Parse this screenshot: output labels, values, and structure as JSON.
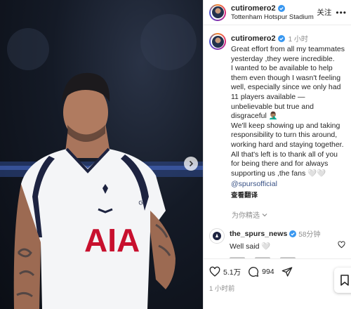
{
  "post": {
    "username": "cutiromero2",
    "location": "Tottenham Hotspur Stadium",
    "follow_label": "关注",
    "time_ago": "1 小时",
    "caption": "Great effort from all my teammates yesterday ,they were incredible.\nI wanted to be available to help them even though I wasn't feeling well, especially since we only had 11 players available — unbelievable but true  and disgraceful 🤦🏽‍♂️\nWe'll keep showing up and taking responsibility to turn this around, working hard and staying together.\nAll that's left is to thank all of you for being there and for always supporting us ,the fans 🤍🤍",
    "mention": "@spursofficial",
    "translate_label": "查看翻译",
    "for_you_label": "为你精选"
  },
  "comment": {
    "username": "the_spurs_news",
    "time_ago": "58分钟",
    "text": "Well said 🤍"
  },
  "actions": {
    "likes": "5.1万",
    "comments": "994",
    "posted": "1 小时前"
  },
  "photo": {
    "jersey_text": "AIA",
    "sleeve_text": "GA"
  },
  "colors": {
    "verified": "#3897f0",
    "link": "#385185",
    "jersey": "#f4f5f7",
    "sponsor": "#c8102e",
    "trim": "#1d2340"
  },
  "icons": [
    "verified-icon",
    "chevron-right-icon",
    "heart-icon",
    "comment-icon",
    "share-icon",
    "bookmark-icon",
    "more-icon"
  ]
}
